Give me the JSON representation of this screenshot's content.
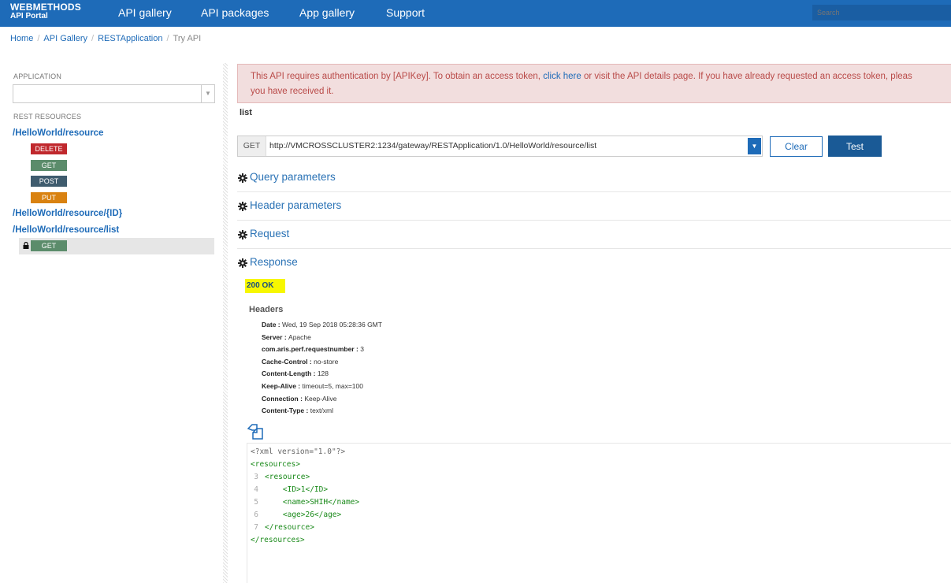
{
  "header": {
    "brand_line1": "WEBMETHODS",
    "brand_line2": "API Portal",
    "nav": [
      "API gallery",
      "API packages",
      "App gallery",
      "Support"
    ],
    "search_placeholder": "Search"
  },
  "breadcrumb": {
    "items": [
      "Home",
      "API Gallery",
      "RESTApplication"
    ],
    "current": "Try API"
  },
  "sidebar": {
    "application_label": "APPLICATION",
    "application_value": "",
    "rest_resources_label": "REST RESOURCES",
    "resources": [
      {
        "path": "/HelloWorld/resource",
        "methods": [
          "DELETE",
          "GET",
          "POST",
          "PUT"
        ]
      },
      {
        "path": "/HelloWorld/resource/{ID}",
        "methods": []
      },
      {
        "path": "/HelloWorld/resource/list",
        "methods": [
          "GET"
        ]
      }
    ]
  },
  "alert": {
    "line1_before": "This API requires authentication by [APIKey]. To obtain an access token, ",
    "line1_link": "click here",
    "line1_after": " or visit the API details page. If you have already requested an access token, pleas",
    "line2": "you have received it."
  },
  "operation": {
    "title": "list",
    "method": "GET",
    "url": "http://VMCROSSCLUSTER2:1234/gateway/RESTApplication/1.0/HelloWorld/resource/list",
    "clear_label": "Clear",
    "test_label": "Test"
  },
  "sections": [
    "Query parameters",
    "Header parameters",
    "Request",
    "Response"
  ],
  "response": {
    "status": "200  OK",
    "headers_title": "Headers",
    "headers": [
      {
        "key": "Date",
        "value": "Wed, 19 Sep 2018 05:28:36 GMT"
      },
      {
        "key": "Server",
        "value": "Apache"
      },
      {
        "key": "com.aris.perf.requestnumber",
        "value": "3"
      },
      {
        "key": "Cache-Control",
        "value": "no-store"
      },
      {
        "key": "Content-Length",
        "value": "128"
      },
      {
        "key": "Keep-Alive",
        "value": "timeout=5, max=100"
      },
      {
        "key": "Connection",
        "value": "Keep-Alive"
      },
      {
        "key": "Content-Type",
        "value": "text/xml"
      }
    ],
    "body_lines": [
      {
        "num": "",
        "text": "<?xml version=\"1.0\"?>"
      },
      {
        "num": "",
        "text": "<resources>"
      },
      {
        "num": "3",
        "text": "<resource>"
      },
      {
        "num": "4",
        "text": "    <ID>1</ID>"
      },
      {
        "num": "5",
        "text": "    <name>SHIH</name>"
      },
      {
        "num": "6",
        "text": "    <age>26</age>"
      },
      {
        "num": "7",
        "text": "</resource>"
      },
      {
        "num": "",
        "text": "</resources>"
      }
    ]
  },
  "colors": {
    "topbar": "#1e6bb8",
    "link": "#1e6bb8",
    "delete": "#c0282d",
    "get": "#5b8c6b",
    "post": "#3f5c6e",
    "put": "#d98211",
    "status_highlight": "#f7f700"
  }
}
